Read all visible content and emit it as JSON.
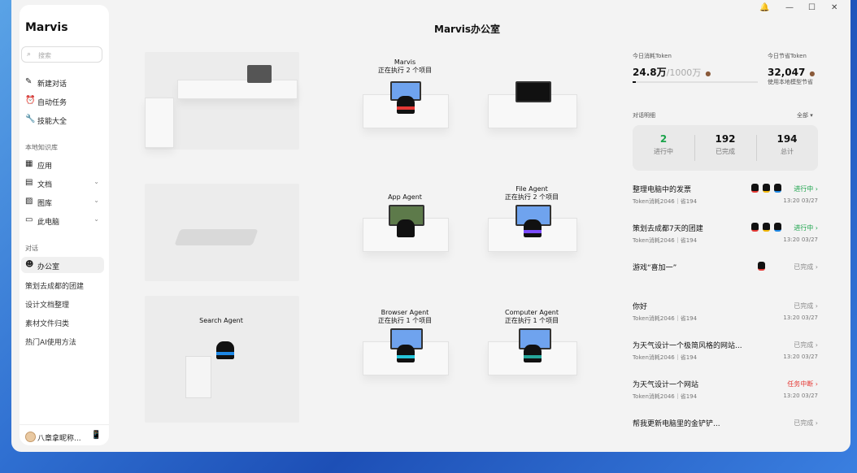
{
  "app": {
    "name": "Marvis"
  },
  "window_controls": {
    "bell": "🔔",
    "minimize": "—",
    "maximize": "☐",
    "close": "✕"
  },
  "sidebar": {
    "search_placeholder": "搜索",
    "top_items": [
      {
        "label": "新建对话",
        "icon": "✎"
      },
      {
        "label": "自动任务",
        "icon": "⏰"
      },
      {
        "label": "技能大全",
        "icon": "🔧"
      }
    ],
    "knowledge_section": "本地知识库",
    "knowledge_items": [
      {
        "label": "应用",
        "icon": "▦"
      },
      {
        "label": "文档",
        "icon": "▤",
        "chevron": "⌄"
      },
      {
        "label": "图库",
        "icon": "▨",
        "chevron": "⌄"
      },
      {
        "label": "此电脑",
        "icon": "▭",
        "chevron": "⌄"
      }
    ],
    "chat_section": "对话",
    "chat_active": {
      "label": "办公室",
      "icon": "☻"
    },
    "chat_items": [
      "策划去成都的团建",
      "设计文档整理",
      "素材文件归类",
      "热门AI使用方法"
    ],
    "user": {
      "name": "八章拿昵称...",
      "phone_icon": "📱"
    }
  },
  "office": {
    "title": "Marvis办公室",
    "agents": [
      {
        "name": "Marvis",
        "status": "正在执行 2 个项目",
        "band": "#e53935"
      },
      {
        "name": "App Agent",
        "status": "",
        "band": "#111111"
      },
      {
        "name": "File Agent",
        "status": "正在执行 2 个项目",
        "band": "#7c4dff"
      },
      {
        "name": "Search Agent",
        "status": "",
        "band": "#1e88e5"
      },
      {
        "name": "Browser Agent",
        "status": "正在执行 1 个项目",
        "band": "#26c6da"
      },
      {
        "name": "Computer Agent",
        "status": "正在执行 1 个项目",
        "band": "#26a69a"
      }
    ]
  },
  "tokens": {
    "today_label": "今日消耗Token",
    "today_value": "24.8万",
    "today_limit": "/1000万",
    "today_fraction": 0.0248,
    "saved_label": "今日节省Token",
    "saved_value": "32,047",
    "saved_sub": "使用本地模型节省",
    "coin": "●"
  },
  "dialog": {
    "label": "对话明细",
    "filter": "全部 ▾",
    "stats": [
      {
        "value": "2",
        "label": "进行中",
        "color": "#1aa34a"
      },
      {
        "value": "192",
        "label": "已完成",
        "color": "#111111"
      },
      {
        "value": "194",
        "label": "总计",
        "color": "#111111"
      }
    ],
    "tasks": [
      {
        "name": "整理电脑中的发票",
        "sub": "Token消耗2046｜省194",
        "status": "进行中 ›",
        "status_color": "#1aa34a",
        "time": "13:20 03/27",
        "agents": 3
      },
      {
        "name": "策划去成都7天的团建",
        "sub": "Token消耗2046｜省194",
        "status": "进行中 ›",
        "status_color": "#1aa34a",
        "time": "13:20 03/27",
        "agents": 3
      },
      {
        "name": "游戏“喜加一”",
        "sub": "",
        "status": "已完成 ›",
        "status_color": "#888888",
        "time": "",
        "agents": 1
      },
      {
        "name": "你好",
        "sub": "Token消耗2046｜省194",
        "status": "已完成 ›",
        "status_color": "#888888",
        "time": "13:20 03/27",
        "agents": 0
      },
      {
        "name": "为天气设计一个极简风格的网站...",
        "sub": "Token消耗2046｜省194",
        "status": "已完成 ›",
        "status_color": "#888888",
        "time": "13:20 03/27",
        "agents": 0
      },
      {
        "name": "为天气设计一个网站",
        "sub": "Token消耗2046｜省194",
        "status": "任务中断 ›",
        "status_color": "#e53935",
        "time": "13:20 03/27",
        "agents": 0
      },
      {
        "name": "帮我更新电脑里的金铲铲...",
        "sub": "",
        "status": "已完成 ›",
        "status_color": "#888888",
        "time": "",
        "agents": 0
      }
    ]
  }
}
